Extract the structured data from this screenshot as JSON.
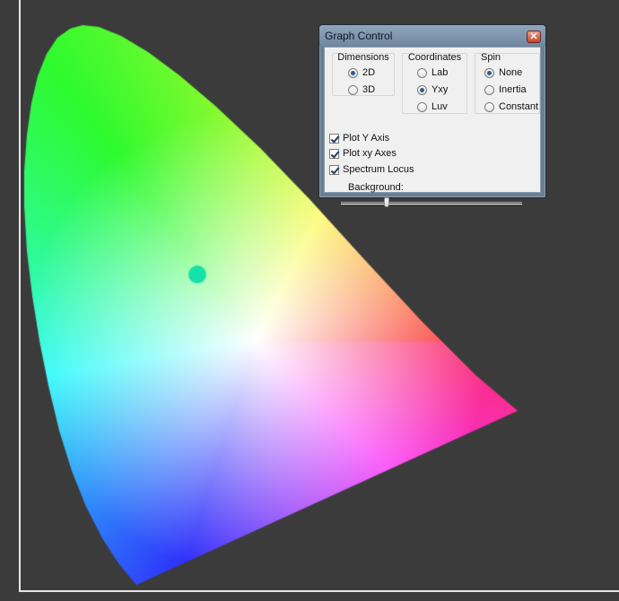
{
  "plot": {
    "dimension": "2D",
    "coordinates": "Yxy",
    "marker_color": "#14e2a9"
  },
  "dialog": {
    "title": "Graph Control",
    "dimensions": {
      "label": "Dimensions",
      "options": [
        "2D",
        "3D"
      ],
      "selected": "2D"
    },
    "coordinates": {
      "label": "Coordinates",
      "options": [
        "Lab",
        "Yxy",
        "Luv"
      ],
      "selected": "Yxy"
    },
    "spin": {
      "label": "Spin",
      "options": [
        "None",
        "Inertia",
        "Constant"
      ],
      "selected": "None"
    },
    "checkboxes": [
      {
        "label": "Plot Y Axis",
        "checked": true
      },
      {
        "label": "Plot xy Axes",
        "checked": true
      },
      {
        "label": "Spectrum Locus",
        "checked": true
      }
    ],
    "background_label": "Background:",
    "background_level": 0.23
  }
}
